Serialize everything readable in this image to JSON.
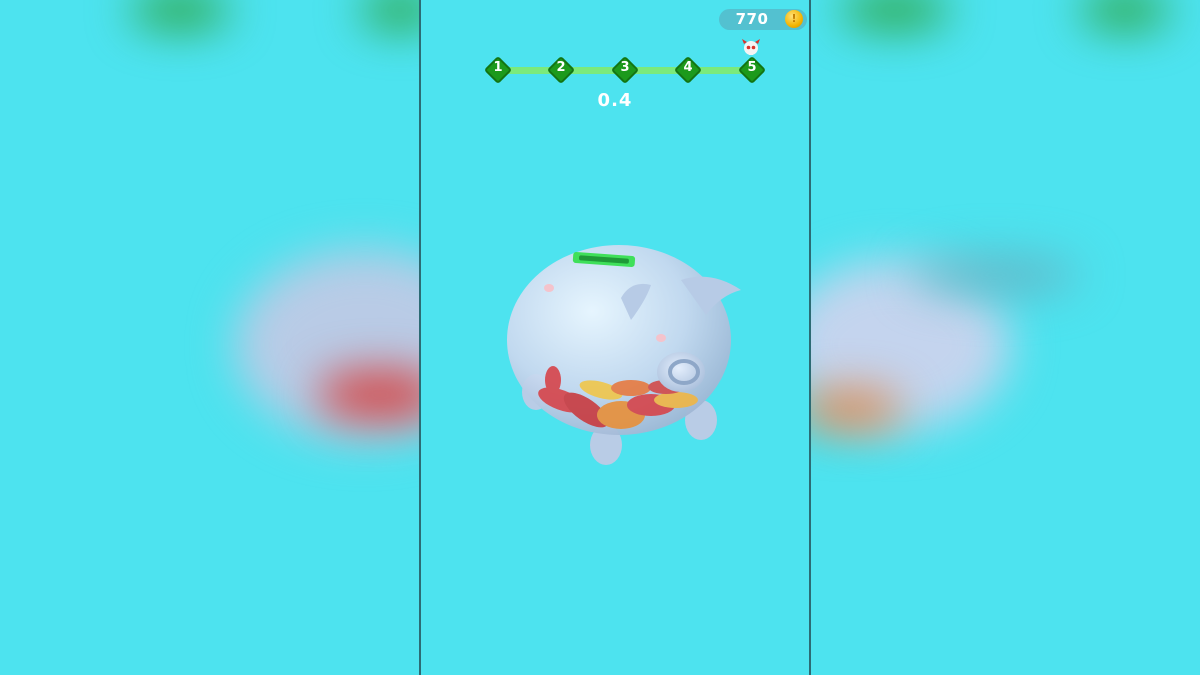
{
  "hud": {
    "coins": "770",
    "coin_icon": "gold-coin-icon",
    "score": "0.4"
  },
  "level_progress": {
    "stages": [
      "1",
      "2",
      "3",
      "4",
      "5"
    ],
    "boss_icon": "skull-boss-icon",
    "colors": {
      "node": "#1c9a1c",
      "track": "#7bea7b"
    }
  },
  "scene": {
    "object": "piggy-bank",
    "background_color": "#4de3ef"
  }
}
